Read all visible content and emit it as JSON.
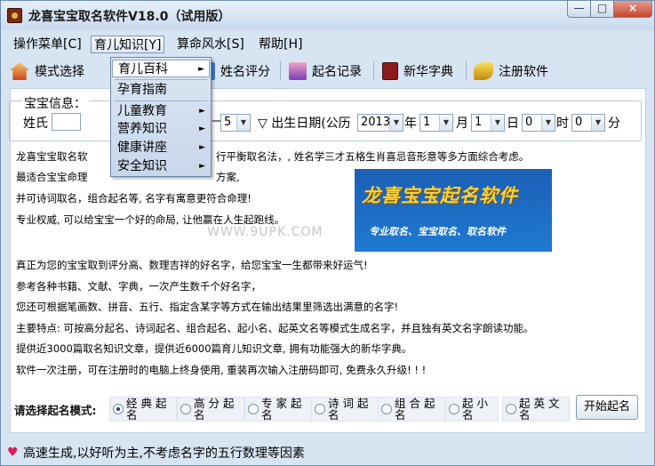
{
  "window": {
    "title": "龙喜宝宝取名软件V18.0（试用版）",
    "controls": {
      "min": "—",
      "max": "□",
      "close": "×"
    }
  },
  "menu": [
    {
      "label": "操作菜单[C]"
    },
    {
      "label": "育儿知识[Y]"
    },
    {
      "label": "算命风水[S]"
    },
    {
      "label": "帮助[H]"
    }
  ],
  "toolbar": {
    "mode": "模式选择",
    "score": "姓名评分",
    "record": "起名记录",
    "dict": "新华字典",
    "register": "注册软件"
  },
  "dropdown": {
    "items": [
      {
        "label": "育儿百科",
        "arrow": "►"
      },
      {
        "label": "孕育指南"
      },
      {
        "label": "儿童教育",
        "arrow": "►"
      },
      {
        "label": "营养知识",
        "arrow": "►"
      },
      {
        "label": "健康讲座",
        "arrow": "►"
      },
      {
        "label": "安全知识",
        "arrow": "►"
      }
    ]
  },
  "baby_info": {
    "legend": "宝宝信息：",
    "surname_label": "姓氏",
    "gender_partial": "—",
    "gender_value": "5",
    "birth_label": "▽ 出生日期(公历",
    "year": "2013",
    "year_unit": "年",
    "month": "1",
    "month_unit": "月",
    "day": "1",
    "day_unit": "日",
    "hour": "0",
    "hour_unit": "时",
    "minute": "0",
    "minute_unit": "分"
  },
  "paragraphs": [
    "龙喜宝宝取名软",
    "行平衡取名法，, 姓名学三才五格生肖喜忌音形意等多方面综合考虑。",
    "最适合宝宝命理",
    "方案,",
    "并可诗词取名，组合起名等, 名字有寓意更符合命理!",
    "专业权威, 可以给宝宝一个好的命局, 让他赢在人生起跑线。",
    "真正为您的宝宝取到评分高、数理吉祥的好名字，给您宝宝一生都带来好运气!",
    "参考各种书籍、文献、字典，一次产生数千个好名字，",
    "您还可根据笔画数、拼音、五行、指定含某字等方式在输出结果里筛选出满意的名字!",
    "主要特点: 可按高分起名、诗词起名、组合起名、起小名、起英文名等模式生成名字，并且独有英文名字朗读功能。",
    "提供近3000篇取名知识文章，提供近6000篇育儿知识文章, 拥有功能强大的新华字典。",
    "软件一次注册，可在注册时的电脑上终身使用, 重装再次输入注册码即可, 免费永久升级! ! !"
  ],
  "banner": {
    "title": "龙喜宝宝起名软件",
    "subtitle": "专业取名、宝宝取名、取名软件"
  },
  "watermark": "WWW.9UPK.COM",
  "modes": {
    "label": "请选择起名模式:",
    "options": [
      "经典起名",
      "高分起名",
      "专家起名",
      "诗词起名",
      "组合起名",
      "起小名",
      "起英文名"
    ],
    "selected": "经典起名",
    "start_button": "开始起名"
  },
  "status": {
    "text": "高速生成,以好听为主,不考虑名字的五行数理等因素",
    "icon": "heart-icon"
  }
}
